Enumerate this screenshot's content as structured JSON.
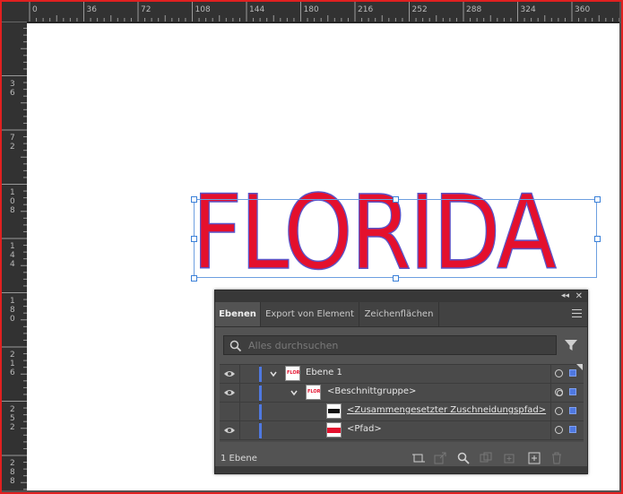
{
  "ruler": {
    "top_ticks": [
      "0",
      "36",
      "72",
      "108",
      "144",
      "180",
      "216",
      "252",
      "288",
      "324",
      "360"
    ],
    "left_ticks": [
      "36",
      "72",
      "108",
      "144",
      "180",
      "216",
      "252",
      "288"
    ]
  },
  "artwork": {
    "text": "FLORIDA",
    "fill_color": "#e4102d",
    "stroke_color": "#5b54c8"
  },
  "layers_panel": {
    "collapse_glyph": "◂◂",
    "close_glyph": "✕",
    "tabs": [
      {
        "label": "Ebenen",
        "active": true
      },
      {
        "label": "Export von Element",
        "active": false
      },
      {
        "label": "Zeichenflächen",
        "active": false
      }
    ],
    "search_placeholder": "Alles durchsuchen",
    "rows": [
      {
        "label": "Ebene 1",
        "underlined": false
      },
      {
        "label": "<Beschnittgruppe>",
        "underlined": false
      },
      {
        "label": "<Zusammengesetzter Zuschneidungspfad>",
        "underlined": true
      },
      {
        "label": "<Pfad>",
        "underlined": false
      }
    ],
    "status": "1 Ebene",
    "layer_color": "#4f78e0"
  }
}
